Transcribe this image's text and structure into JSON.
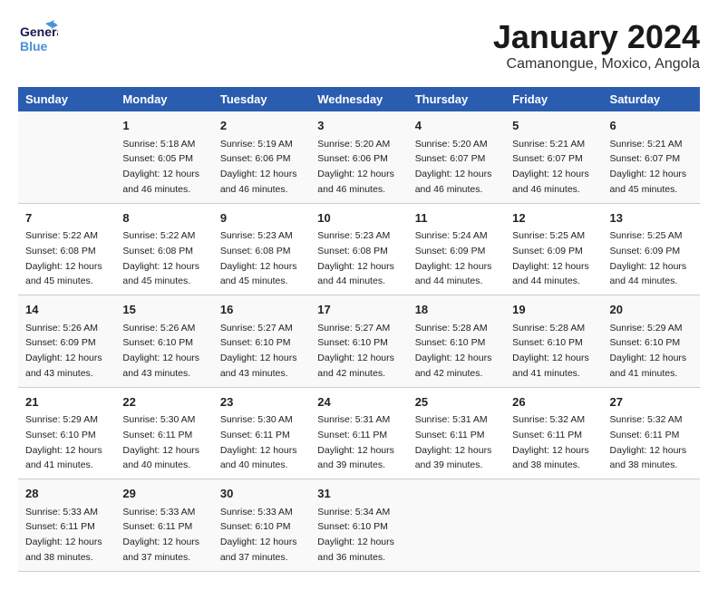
{
  "header": {
    "logo_line1": "General",
    "logo_line2": "Blue",
    "title": "January 2024",
    "subtitle": "Camanongue, Moxico, Angola"
  },
  "days_of_week": [
    "Sunday",
    "Monday",
    "Tuesday",
    "Wednesday",
    "Thursday",
    "Friday",
    "Saturday"
  ],
  "weeks": [
    [
      {
        "date": "",
        "sunrise": "",
        "sunset": "",
        "daylight": ""
      },
      {
        "date": "1",
        "sunrise": "Sunrise: 5:18 AM",
        "sunset": "Sunset: 6:05 PM",
        "daylight": "Daylight: 12 hours and 46 minutes."
      },
      {
        "date": "2",
        "sunrise": "Sunrise: 5:19 AM",
        "sunset": "Sunset: 6:06 PM",
        "daylight": "Daylight: 12 hours and 46 minutes."
      },
      {
        "date": "3",
        "sunrise": "Sunrise: 5:20 AM",
        "sunset": "Sunset: 6:06 PM",
        "daylight": "Daylight: 12 hours and 46 minutes."
      },
      {
        "date": "4",
        "sunrise": "Sunrise: 5:20 AM",
        "sunset": "Sunset: 6:07 PM",
        "daylight": "Daylight: 12 hours and 46 minutes."
      },
      {
        "date": "5",
        "sunrise": "Sunrise: 5:21 AM",
        "sunset": "Sunset: 6:07 PM",
        "daylight": "Daylight: 12 hours and 46 minutes."
      },
      {
        "date": "6",
        "sunrise": "Sunrise: 5:21 AM",
        "sunset": "Sunset: 6:07 PM",
        "daylight": "Daylight: 12 hours and 45 minutes."
      }
    ],
    [
      {
        "date": "7",
        "sunrise": "Sunrise: 5:22 AM",
        "sunset": "Sunset: 6:08 PM",
        "daylight": "Daylight: 12 hours and 45 minutes."
      },
      {
        "date": "8",
        "sunrise": "Sunrise: 5:22 AM",
        "sunset": "Sunset: 6:08 PM",
        "daylight": "Daylight: 12 hours and 45 minutes."
      },
      {
        "date": "9",
        "sunrise": "Sunrise: 5:23 AM",
        "sunset": "Sunset: 6:08 PM",
        "daylight": "Daylight: 12 hours and 45 minutes."
      },
      {
        "date": "10",
        "sunrise": "Sunrise: 5:23 AM",
        "sunset": "Sunset: 6:08 PM",
        "daylight": "Daylight: 12 hours and 44 minutes."
      },
      {
        "date": "11",
        "sunrise": "Sunrise: 5:24 AM",
        "sunset": "Sunset: 6:09 PM",
        "daylight": "Daylight: 12 hours and 44 minutes."
      },
      {
        "date": "12",
        "sunrise": "Sunrise: 5:25 AM",
        "sunset": "Sunset: 6:09 PM",
        "daylight": "Daylight: 12 hours and 44 minutes."
      },
      {
        "date": "13",
        "sunrise": "Sunrise: 5:25 AM",
        "sunset": "Sunset: 6:09 PM",
        "daylight": "Daylight: 12 hours and 44 minutes."
      }
    ],
    [
      {
        "date": "14",
        "sunrise": "Sunrise: 5:26 AM",
        "sunset": "Sunset: 6:09 PM",
        "daylight": "Daylight: 12 hours and 43 minutes."
      },
      {
        "date": "15",
        "sunrise": "Sunrise: 5:26 AM",
        "sunset": "Sunset: 6:10 PM",
        "daylight": "Daylight: 12 hours and 43 minutes."
      },
      {
        "date": "16",
        "sunrise": "Sunrise: 5:27 AM",
        "sunset": "Sunset: 6:10 PM",
        "daylight": "Daylight: 12 hours and 43 minutes."
      },
      {
        "date": "17",
        "sunrise": "Sunrise: 5:27 AM",
        "sunset": "Sunset: 6:10 PM",
        "daylight": "Daylight: 12 hours and 42 minutes."
      },
      {
        "date": "18",
        "sunrise": "Sunrise: 5:28 AM",
        "sunset": "Sunset: 6:10 PM",
        "daylight": "Daylight: 12 hours and 42 minutes."
      },
      {
        "date": "19",
        "sunrise": "Sunrise: 5:28 AM",
        "sunset": "Sunset: 6:10 PM",
        "daylight": "Daylight: 12 hours and 41 minutes."
      },
      {
        "date": "20",
        "sunrise": "Sunrise: 5:29 AM",
        "sunset": "Sunset: 6:10 PM",
        "daylight": "Daylight: 12 hours and 41 minutes."
      }
    ],
    [
      {
        "date": "21",
        "sunrise": "Sunrise: 5:29 AM",
        "sunset": "Sunset: 6:10 PM",
        "daylight": "Daylight: 12 hours and 41 minutes."
      },
      {
        "date": "22",
        "sunrise": "Sunrise: 5:30 AM",
        "sunset": "Sunset: 6:11 PM",
        "daylight": "Daylight: 12 hours and 40 minutes."
      },
      {
        "date": "23",
        "sunrise": "Sunrise: 5:30 AM",
        "sunset": "Sunset: 6:11 PM",
        "daylight": "Daylight: 12 hours and 40 minutes."
      },
      {
        "date": "24",
        "sunrise": "Sunrise: 5:31 AM",
        "sunset": "Sunset: 6:11 PM",
        "daylight": "Daylight: 12 hours and 39 minutes."
      },
      {
        "date": "25",
        "sunrise": "Sunrise: 5:31 AM",
        "sunset": "Sunset: 6:11 PM",
        "daylight": "Daylight: 12 hours and 39 minutes."
      },
      {
        "date": "26",
        "sunrise": "Sunrise: 5:32 AM",
        "sunset": "Sunset: 6:11 PM",
        "daylight": "Daylight: 12 hours and 38 minutes."
      },
      {
        "date": "27",
        "sunrise": "Sunrise: 5:32 AM",
        "sunset": "Sunset: 6:11 PM",
        "daylight": "Daylight: 12 hours and 38 minutes."
      }
    ],
    [
      {
        "date": "28",
        "sunrise": "Sunrise: 5:33 AM",
        "sunset": "Sunset: 6:11 PM",
        "daylight": "Daylight: 12 hours and 38 minutes."
      },
      {
        "date": "29",
        "sunrise": "Sunrise: 5:33 AM",
        "sunset": "Sunset: 6:11 PM",
        "daylight": "Daylight: 12 hours and 37 minutes."
      },
      {
        "date": "30",
        "sunrise": "Sunrise: 5:33 AM",
        "sunset": "Sunset: 6:10 PM",
        "daylight": "Daylight: 12 hours and 37 minutes."
      },
      {
        "date": "31",
        "sunrise": "Sunrise: 5:34 AM",
        "sunset": "Sunset: 6:10 PM",
        "daylight": "Daylight: 12 hours and 36 minutes."
      },
      {
        "date": "",
        "sunrise": "",
        "sunset": "",
        "daylight": ""
      },
      {
        "date": "",
        "sunrise": "",
        "sunset": "",
        "daylight": ""
      },
      {
        "date": "",
        "sunrise": "",
        "sunset": "",
        "daylight": ""
      }
    ]
  ]
}
